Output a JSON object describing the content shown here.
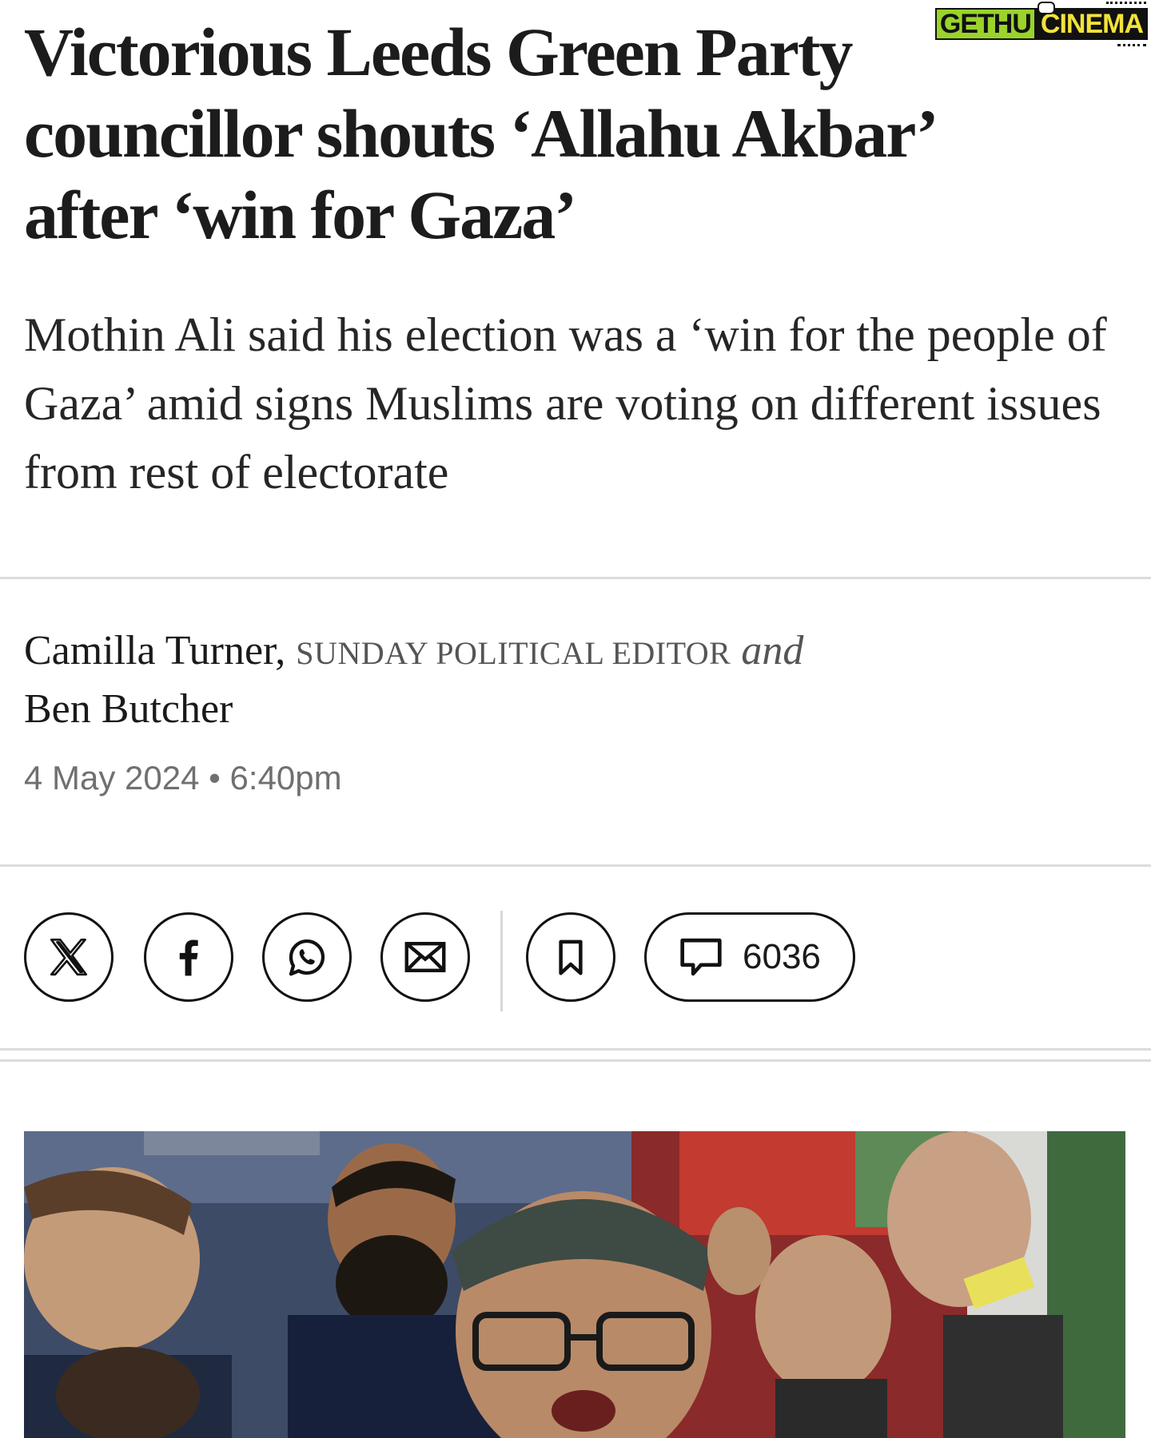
{
  "watermark": {
    "part1": "GETHU",
    "part2": "CINEMA"
  },
  "article": {
    "headline": "Victorious Leeds Green Party councillor shouts ‘Allahu Akbar’ after ‘win for Gaza’",
    "standfirst": "Mothin Ali said his election was a ‘win for the people of Gaza’ amid signs Muslims are voting on different issues from rest of electorate",
    "byline": {
      "author1": "Camilla Turner,",
      "author1_role": "SUNDAY POLITICAL EDITOR",
      "conjunction": "and",
      "author2": "Ben Butcher"
    },
    "date": "4 May 2024",
    "separator": "•",
    "time": "6:40pm"
  },
  "share": {
    "icons": [
      "x-icon",
      "facebook-icon",
      "whatsapp-icon",
      "email-icon",
      "bookmark-icon",
      "comment-icon"
    ],
    "comment_count": "6036"
  },
  "colors": {
    "text": "#1c1c1c",
    "meta": "#707070",
    "divider": "#dcdcdc",
    "watermark_green": "#9ad32a",
    "watermark_yellow": "#f2e23a"
  }
}
